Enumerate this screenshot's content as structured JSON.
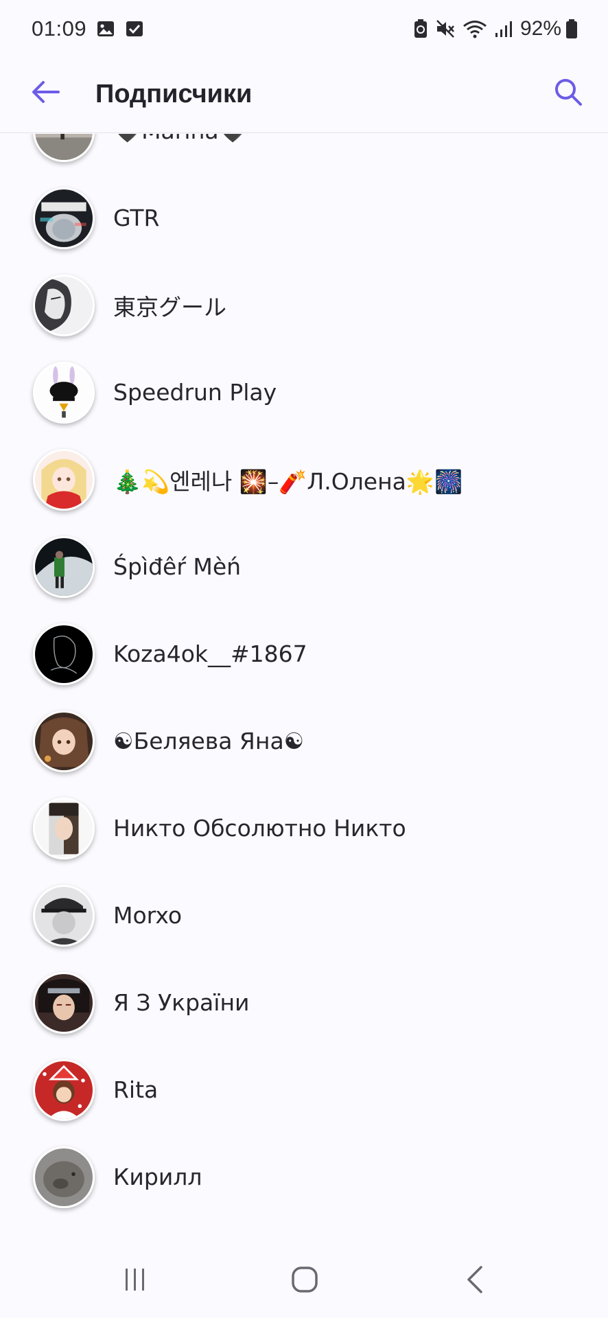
{
  "status_bar": {
    "time": "01:09",
    "battery": "92%",
    "icons": [
      "gallery-icon",
      "checkbox-icon",
      "battery-saver-icon",
      "mute-icon",
      "wifi-icon",
      "signal-icon",
      "battery-icon"
    ]
  },
  "app_bar": {
    "title": "Подписчики",
    "back_icon": "arrow-left-icon",
    "search_icon": "search-icon",
    "accent": "#6c5ce7"
  },
  "subscribers": [
    {
      "name": "🖤Marina🖤"
    },
    {
      "name": "GTR"
    },
    {
      "name": "東京グール"
    },
    {
      "name": "Speedrun Play"
    },
    {
      "name": "🎄💫엔레나 🎇–🧨Л.Олена🌟🎆"
    },
    {
      "name": "Śpìđêŕ Mèń"
    },
    {
      "name": "Koza4ok__#1867"
    },
    {
      "name": "☯Беляева Яна☯"
    },
    {
      "name": "Никто Обсолютно Никто"
    },
    {
      "name": "Morxo"
    },
    {
      "name": "Я З України"
    },
    {
      "name": "Rita"
    },
    {
      "name": "Кирилл"
    }
  ],
  "nav_bar": {
    "items": [
      "recents-icon",
      "home-icon",
      "back-icon"
    ]
  }
}
